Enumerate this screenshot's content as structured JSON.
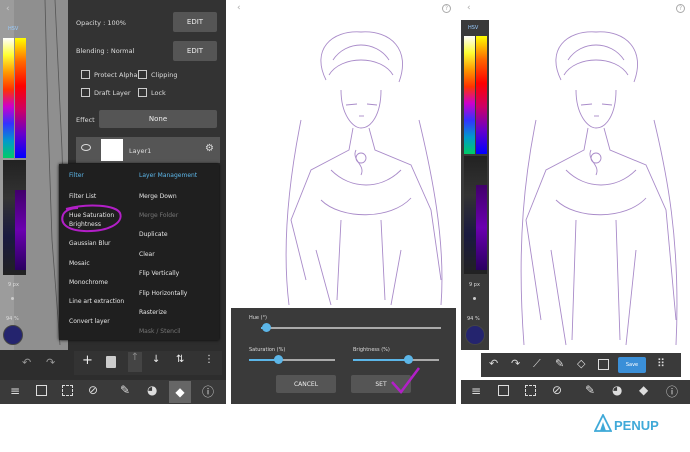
{
  "panel1": {
    "hsv_label": "HSV",
    "opacity_label": "Opacity : 100%",
    "blending_label": "Blending : Normal",
    "edit_label": "EDIT",
    "protect_alpha": "Protect Alpha",
    "clipping": "Clipping",
    "draft_layer": "Draft Layer",
    "lock": "Lock",
    "effect_label": "Effect",
    "effect_value": "None",
    "layer_name": "Layer1",
    "size_label": "9 px",
    "opacity_small": "94 %",
    "filter_header": "Filter",
    "layer_mgmt_header": "Layer Management",
    "filter_items": [
      "Filter List",
      "Hue Saturation Brightness",
      "Gaussian Blur",
      "Mosaic",
      "Monochrome",
      "Line art extraction",
      "Convert layer"
    ],
    "mgmt_items": [
      "Merge Down",
      "Merge Folder",
      "Duplicate",
      "Clear",
      "Flip Vertically",
      "Flip Horizontally",
      "Rasterize",
      "Mask / Stencil"
    ]
  },
  "panel2": {
    "help": "?",
    "hue_label": "Hue (°)",
    "saturation_label": "Saturation (%)",
    "brightness_label": "Brightness (%)",
    "cancel_label": "CANCEL",
    "set_label": "SET",
    "hue_value": 0.05,
    "saturation_value": 0.35,
    "brightness_value": 0.62
  },
  "panel3": {
    "hsv_label": "HSV",
    "size_label": "9 px",
    "opacity_small": "94 %",
    "save_label": "Save",
    "help": "?"
  },
  "brand": {
    "logo_text": "PENUP",
    "accent": "#3fa9d8"
  },
  "colors": {
    "highlight_circle": "#b21fc7",
    "sketch": "#a98bc9",
    "dark_panel": "#3a3a3a",
    "save_blue": "#3a8fd8"
  }
}
